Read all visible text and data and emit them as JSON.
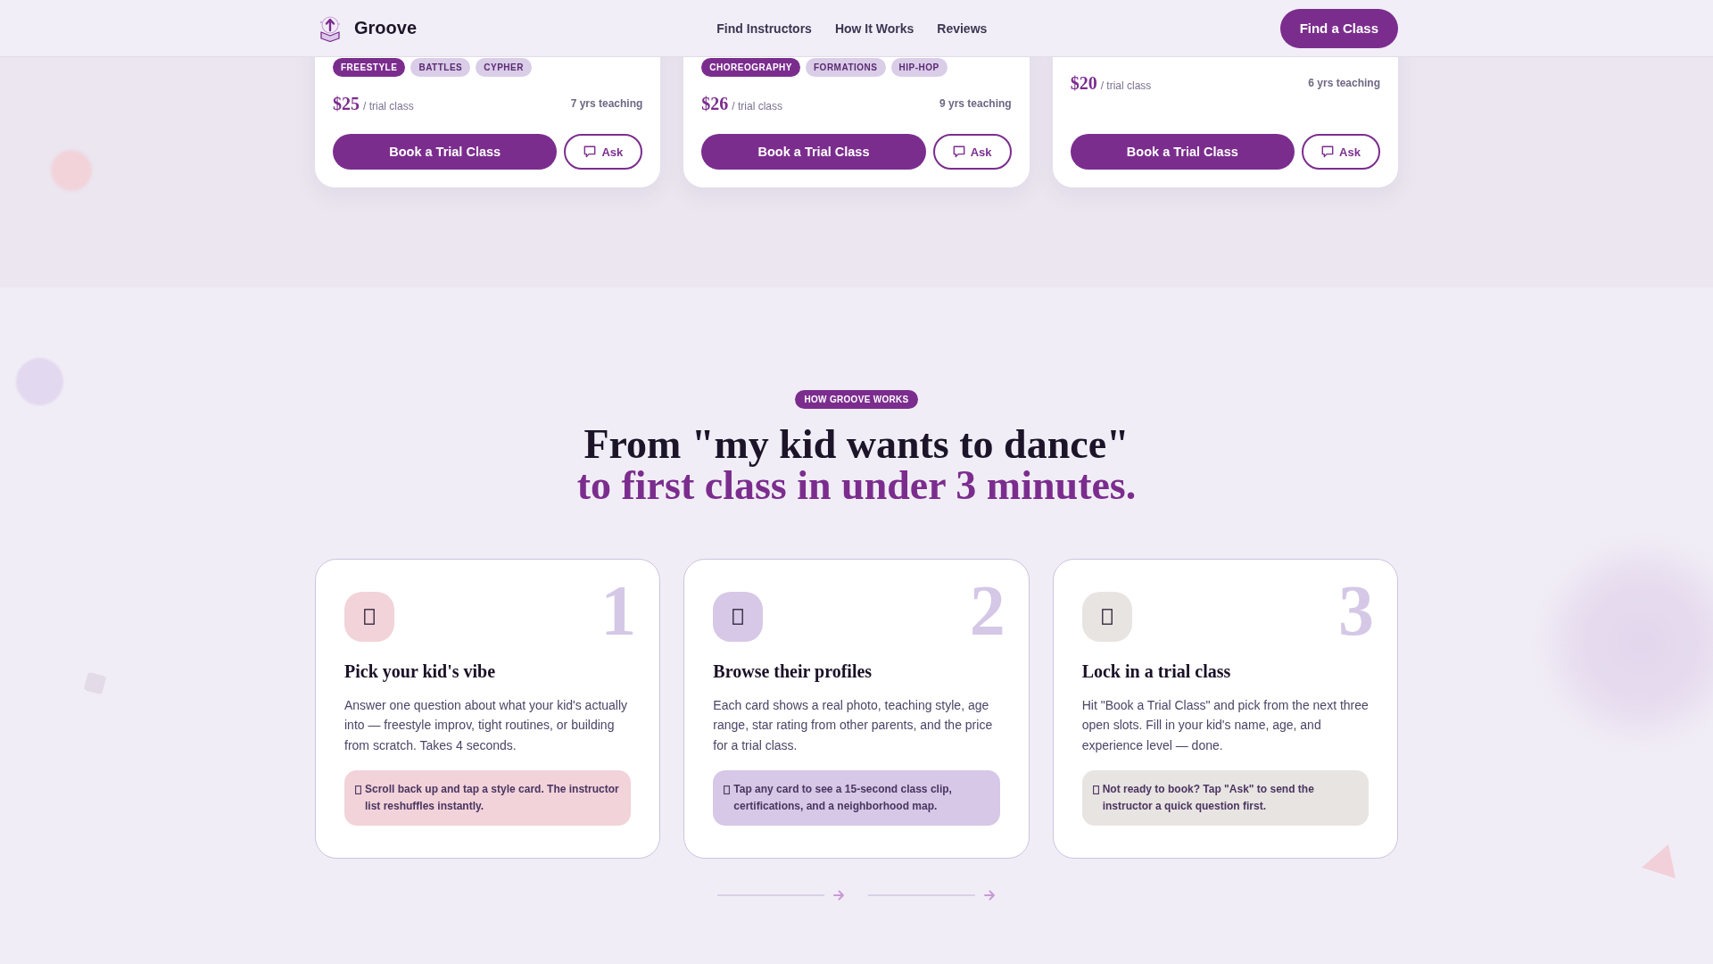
{
  "header": {
    "brand": "Groove",
    "nav": [
      "Find Instructors",
      "How It Works",
      "Reviews"
    ],
    "cta": "Find a Class"
  },
  "instructor_cards": [
    {
      "tags": [
        {
          "label": "FREESTYLE",
          "primary": true
        },
        {
          "label": "BATTLES",
          "primary": false
        },
        {
          "label": "CYPHER",
          "primary": false
        }
      ],
      "price": "$25",
      "price_unit": "/ trial class",
      "experience": "7 yrs teaching",
      "book_button": "Book a Trial Class",
      "ask_button": "Ask"
    },
    {
      "tags": [
        {
          "label": "CHOREOGRAPHY",
          "primary": true
        },
        {
          "label": "FORMATIONS",
          "primary": false
        },
        {
          "label": "HIP-HOP",
          "primary": false
        }
      ],
      "price": "$26",
      "price_unit": "/ trial class",
      "experience": "9 yrs teaching",
      "book_button": "Book a Trial Class",
      "ask_button": "Ask"
    },
    {
      "price": "$20",
      "price_unit": "/ trial class",
      "experience": "6 yrs teaching",
      "book_button": "Book a Trial Class",
      "ask_button": "Ask"
    }
  ],
  "how_it_works": {
    "badge": "HOW GROOVE WORKS",
    "heading": "From \"my kid wants to dance\"",
    "heading_accent": "to first class in under 3 minutes.",
    "steps": [
      {
        "number": "1",
        "title": "Pick your kid's vibe",
        "description": "Answer one question about what your kid's actually into — freestyle improv, tight routines, or building from scratch. Takes 4 seconds.",
        "tip": "Scroll back up and tap a style card. The instructor list reshuffles instantly.",
        "color": "#f2d3da"
      },
      {
        "number": "2",
        "title": "Browse their profiles",
        "description": "Each card shows a real photo, teaching style, age range, star rating from other parents, and the price for a trial class.",
        "tip": "Tap any card to see a 15-second class clip, certifications, and a neighborhood map.",
        "color": "#d6c8e6"
      },
      {
        "number": "3",
        "title": "Lock in a trial class",
        "description": "Hit \"Book a Trial Class\" and pick from the next three open slots. Fill in your kid's name, age, and experience level — done.",
        "tip": "Not ready to book? Tap \"Ask\" to send the instructor a quick question first.",
        "color": "#e8e4e2"
      }
    ]
  }
}
